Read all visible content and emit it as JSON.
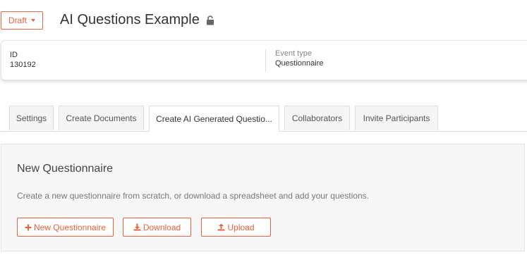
{
  "header": {
    "status_label": "Draft",
    "title": "AI Questions Example",
    "title_icon": "lock-icon"
  },
  "info": {
    "id_label": "ID",
    "id_value": "130192",
    "event_type_label": "Event type",
    "event_type_value": "Questionnaire"
  },
  "tabs": [
    {
      "label": "Settings",
      "active": false
    },
    {
      "label": "Create Documents",
      "active": false
    },
    {
      "label": "Create AI Generated Questio...",
      "active": true
    },
    {
      "label": "Collaborators",
      "active": false
    },
    {
      "label": "Invite Participants",
      "active": false
    }
  ],
  "panel": {
    "title": "New Questionnaire",
    "description": "Create a new questionnaire from scratch, or download a spreadsheet and add your questions.",
    "buttons": {
      "new_label": "New Questionnaire",
      "new_icon": "plus-icon",
      "download_label": "Download",
      "download_icon": "download-icon",
      "upload_label": "Upload",
      "upload_icon": "upload-icon"
    }
  },
  "colors": {
    "accent": "#e8603c",
    "panel_bg": "#f7f7f7",
    "tab_bg": "#f5f5f5"
  }
}
